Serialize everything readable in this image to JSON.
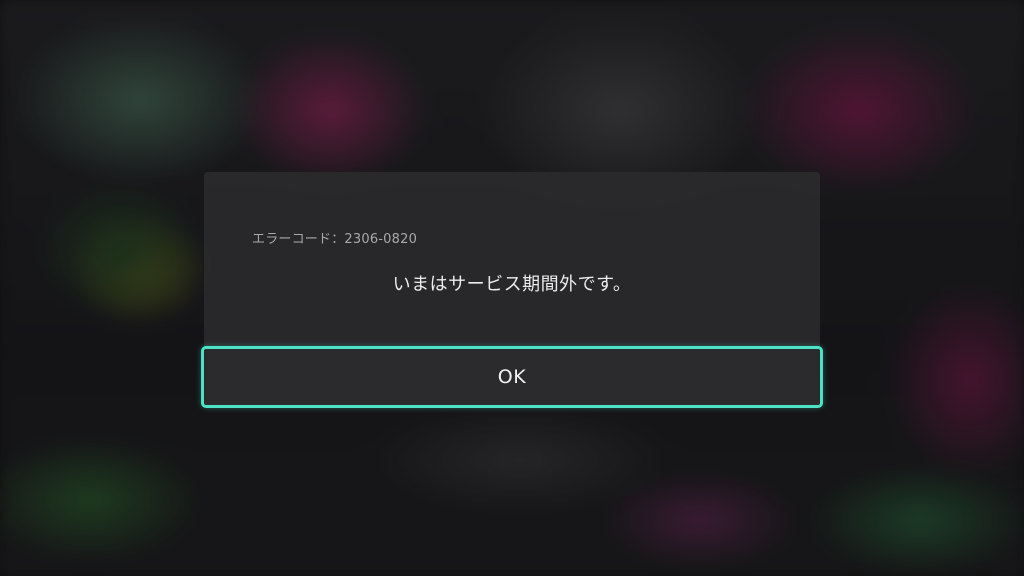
{
  "dialog": {
    "error_code": "エラーコード：2306-0820",
    "message": "いまはサービス期間外です。",
    "ok_label": "OK"
  },
  "colors": {
    "focus_accent": "#4de2c6",
    "dialog_background": "#2a2a2c",
    "primary_text": "#ececec",
    "secondary_text": "#a8a8a8"
  }
}
